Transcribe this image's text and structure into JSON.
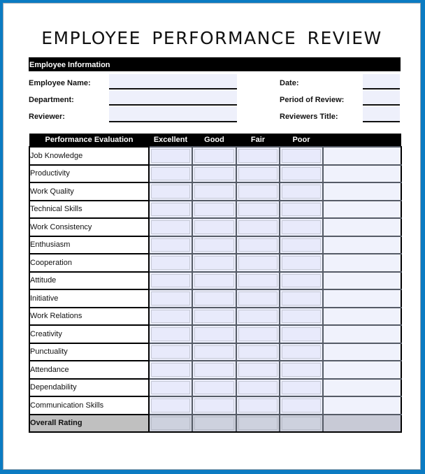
{
  "title": "EMPLOYEE  PERFORMANCE  REVIEW",
  "info": {
    "header": "Employee Information",
    "fields_left": [
      {
        "label": "Employee Name:",
        "value": ""
      },
      {
        "label": "Department:",
        "value": ""
      },
      {
        "label": "Reviewer:",
        "value": ""
      }
    ],
    "fields_right": [
      {
        "label": "Date:",
        "value": ""
      },
      {
        "label": "Period of Review:",
        "value": ""
      },
      {
        "label": "Reviewers Title:",
        "value": ""
      }
    ]
  },
  "evaluation": {
    "columns": [
      "Performance Evaluation",
      "Excellent",
      "Good",
      "Fair",
      "Poor",
      ""
    ],
    "criteria": [
      "Job Knowledge",
      "Productivity",
      "Work Quality",
      "Technical Skills",
      "Work Consistency",
      "Enthusiasm",
      "Cooperation",
      "Attitude",
      "Initiative",
      "Work Relations",
      "Creativity",
      "Punctuality",
      "Attendance",
      "Dependability",
      "Communication Skills"
    ],
    "overall_label": "Overall Rating"
  },
  "colors": {
    "frame": "#0b7bc2",
    "header_bg": "#000000",
    "field_bg": "#eef0fb",
    "overall_bg": "#c0c0c0"
  }
}
